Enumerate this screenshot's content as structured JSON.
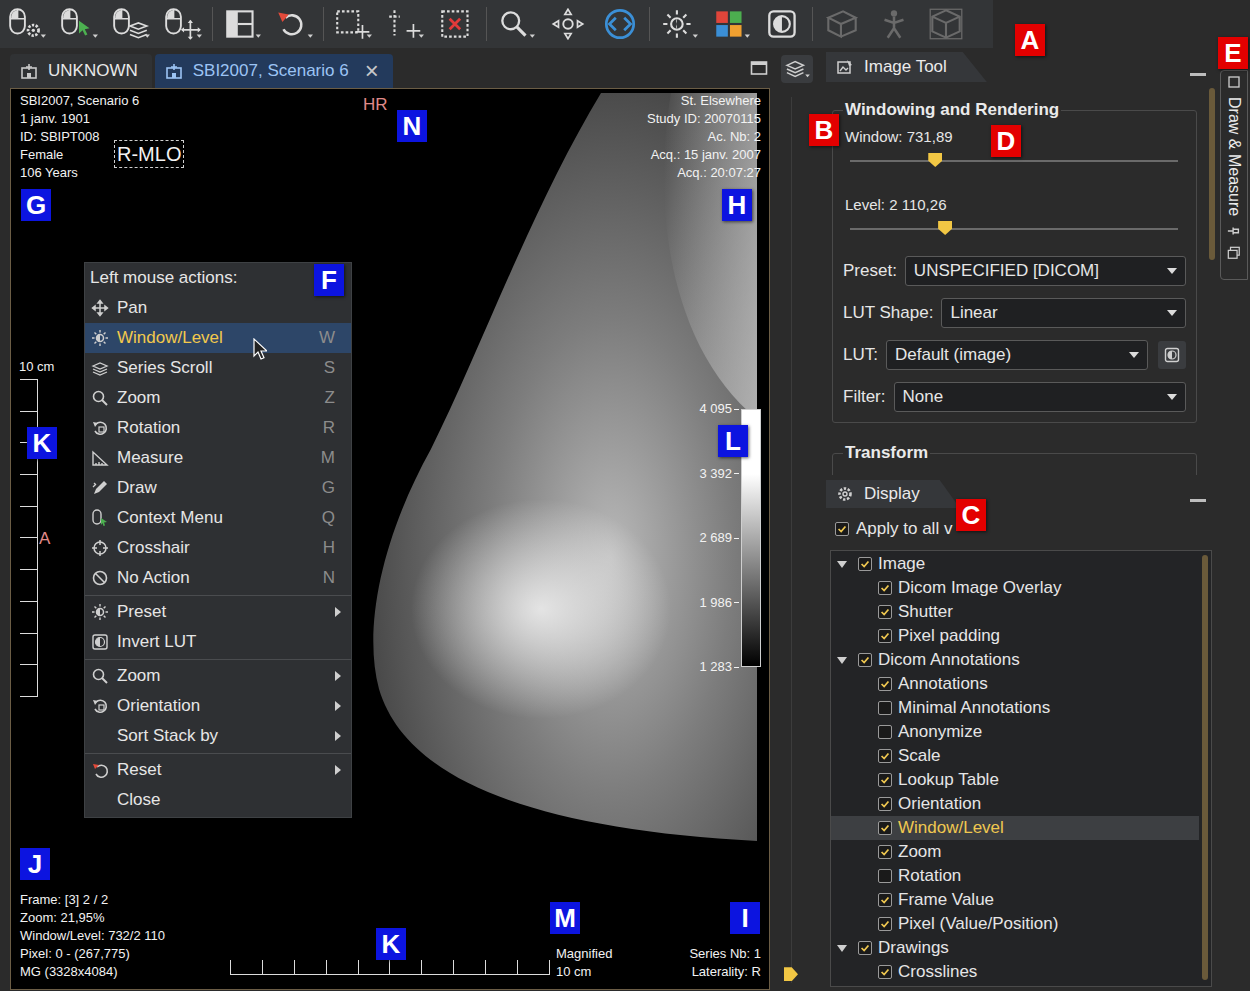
{
  "tabs": [
    {
      "label": "UNKNOWN",
      "selected": false
    },
    {
      "label": "SBI2007, Scenario 6",
      "selected": true,
      "close": "×"
    }
  ],
  "viewer": {
    "patient": [
      "SBI2007, Scenario 6",
      "1 janv. 1901",
      "ID: SBIPT008",
      "Female",
      "106 Years"
    ],
    "view_label": "R-MLO",
    "laterality_marker": "HR",
    "study": [
      "St. Elsewhere",
      "Study ID: 20070115",
      "Ac. Nb: 2",
      "Acq.: 15 janv. 2007",
      "Acq.: 20:07:27"
    ],
    "frame_info": [
      "Frame: [3] 2 / 2",
      "Zoom: 21,95%",
      "Window/Level: 732/2 110",
      "Pixel: 0 - (267,775)",
      "MG (3328x4084)"
    ],
    "series_info": [
      "Series Nb: 1",
      "Laterality: R"
    ],
    "vertical_scale": {
      "label": "10 cm",
      "orientation": "A"
    },
    "horizontal_scale": {
      "lines": [
        "Magnified",
        "10 cm"
      ]
    },
    "lut_bar": {
      "ticks": [
        "4 095",
        "3 392",
        "2 689",
        "1 986",
        "1 283"
      ]
    }
  },
  "series_slider": {
    "level": 0.99
  },
  "context_menu": {
    "title": "Left mouse actions:",
    "items": [
      {
        "kind": "action",
        "label": "Pan",
        "shortcut": "",
        "selected": false
      },
      {
        "kind": "action",
        "label": "Window/Level",
        "shortcut": "W",
        "selected": true
      },
      {
        "kind": "action",
        "label": "Series Scroll",
        "shortcut": "S",
        "selected": false
      },
      {
        "kind": "action",
        "label": "Zoom",
        "shortcut": "Z",
        "selected": false
      },
      {
        "kind": "action",
        "label": "Rotation",
        "shortcut": "R",
        "selected": false
      },
      {
        "kind": "action",
        "label": "Measure",
        "shortcut": "M",
        "selected": false
      },
      {
        "kind": "action",
        "label": "Draw",
        "shortcut": "G",
        "selected": false
      },
      {
        "kind": "action",
        "label": "Context Menu",
        "shortcut": "Q",
        "selected": false
      },
      {
        "kind": "action",
        "label": "Crosshair",
        "shortcut": "H",
        "selected": false
      },
      {
        "kind": "action",
        "label": "No Action",
        "shortcut": "N",
        "selected": false
      },
      {
        "kind": "separator"
      },
      {
        "kind": "submenu",
        "label": "Preset",
        "shortcut": "",
        "selected": false
      },
      {
        "kind": "action",
        "label": "Invert LUT",
        "shortcut": "",
        "selected": false
      },
      {
        "kind": "separator"
      },
      {
        "kind": "submenu",
        "label": "Zoom",
        "shortcut": "",
        "selected": false
      },
      {
        "kind": "submenu",
        "label": "Orientation",
        "shortcut": "",
        "selected": false
      },
      {
        "kind": "submenu",
        "label": "Sort Stack by",
        "shortcut": "",
        "selected": false
      },
      {
        "kind": "separator"
      },
      {
        "kind": "submenu",
        "label": "Reset",
        "shortcut": "",
        "selected": false
      },
      {
        "kind": "action",
        "label": "Close",
        "shortcut": "",
        "selected": false
      }
    ]
  },
  "image_tool": {
    "title": "Image Tool",
    "group": "Windowing and Rendering",
    "sliders": [
      {
        "label": "Window: 731,89",
        "level": 0.26
      },
      {
        "label": "Level: 2 110,26",
        "level": 0.29
      }
    ],
    "fields": [
      {
        "label": "Preset:",
        "value": "UNSPECIFIED [DICOM]",
        "has_button": false
      },
      {
        "label": "LUT Shape:",
        "value": "Linear",
        "has_button": false
      },
      {
        "label": "LUT:",
        "value": "Default (image)",
        "has_button": true
      },
      {
        "label": "Filter:",
        "value": "None",
        "has_button": false
      }
    ],
    "next_group": "Transform"
  },
  "display": {
    "title": "Display",
    "apply_to_all": {
      "label": "Apply to all v",
      "checked": true
    },
    "tree": [
      {
        "label": "Image",
        "depth": 0,
        "expandable": true,
        "expanded": true,
        "checked": true,
        "selected": false
      },
      {
        "label": "Dicom Image Overlay",
        "depth": 1,
        "expandable": false,
        "expanded": false,
        "checked": true,
        "selected": false
      },
      {
        "label": "Shutter",
        "depth": 1,
        "expandable": false,
        "expanded": false,
        "checked": true,
        "selected": false
      },
      {
        "label": "Pixel padding",
        "depth": 1,
        "expandable": false,
        "expanded": false,
        "checked": true,
        "selected": false
      },
      {
        "label": "Dicom Annotations",
        "depth": 0,
        "expandable": true,
        "expanded": true,
        "checked": true,
        "selected": false
      },
      {
        "label": "Annotations",
        "depth": 1,
        "expandable": false,
        "expanded": false,
        "checked": true,
        "selected": false
      },
      {
        "label": "Minimal Annotations",
        "depth": 1,
        "expandable": false,
        "expanded": false,
        "checked": false,
        "selected": false
      },
      {
        "label": "Anonymize",
        "depth": 1,
        "expandable": false,
        "expanded": false,
        "checked": false,
        "selected": false
      },
      {
        "label": "Scale",
        "depth": 1,
        "expandable": false,
        "expanded": false,
        "checked": true,
        "selected": false
      },
      {
        "label": "Lookup Table",
        "depth": 1,
        "expandable": false,
        "expanded": false,
        "checked": true,
        "selected": false
      },
      {
        "label": "Orientation",
        "depth": 1,
        "expandable": false,
        "expanded": false,
        "checked": true,
        "selected": false
      },
      {
        "label": "Window/Level",
        "depth": 1,
        "expandable": false,
        "expanded": false,
        "checked": true,
        "selected": true
      },
      {
        "label": "Zoom",
        "depth": 1,
        "expandable": false,
        "expanded": false,
        "checked": true,
        "selected": false
      },
      {
        "label": "Rotation",
        "depth": 1,
        "expandable": false,
        "expanded": false,
        "checked": false,
        "selected": false
      },
      {
        "label": "Frame Value",
        "depth": 1,
        "expandable": false,
        "expanded": false,
        "checked": true,
        "selected": false
      },
      {
        "label": "Pixel (Value/Position)",
        "depth": 1,
        "expandable": false,
        "expanded": false,
        "checked": true,
        "selected": false
      },
      {
        "label": "Drawings",
        "depth": 0,
        "expandable": true,
        "expanded": true,
        "checked": true,
        "selected": false
      },
      {
        "label": "Crosslines",
        "depth": 1,
        "expandable": false,
        "expanded": false,
        "checked": true,
        "selected": false
      }
    ]
  },
  "side_tab": {
    "label": "Draw & Measure"
  },
  "badges": [
    {
      "label": "A",
      "color": "#e30000"
    },
    {
      "label": "B",
      "color": "#e30000"
    },
    {
      "label": "C",
      "color": "#e30000"
    },
    {
      "label": "D",
      "color": "#e30000"
    },
    {
      "label": "E",
      "color": "#e30000"
    },
    {
      "label": "F",
      "color": "#0c14e0"
    },
    {
      "label": "G",
      "color": "#0c14e0"
    },
    {
      "label": "H",
      "color": "#0c14e0"
    },
    {
      "label": "I",
      "color": "#0c14e0"
    },
    {
      "label": "J",
      "color": "#0c14e0"
    },
    {
      "label": "K",
      "color": "#0c14e0"
    },
    {
      "label": "K",
      "color": "#0c14e0"
    },
    {
      "label": "L",
      "color": "#0c14e0"
    },
    {
      "label": "M",
      "color": "#0c14e0"
    },
    {
      "label": "N",
      "color": "#0c14e0"
    }
  ]
}
